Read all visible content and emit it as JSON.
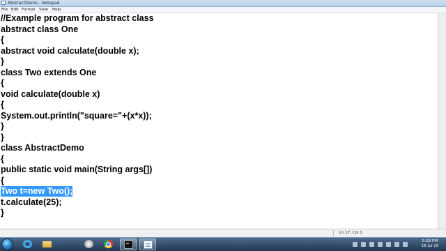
{
  "window": {
    "title": "AbstractDemo - Notepad"
  },
  "menu": [
    "File",
    "Edit",
    "Format",
    "View",
    "Help"
  ],
  "editor": {
    "lines": [
      "//Example program for abstract class",
      "abstract class One",
      "{",
      "abstract void calculate(double x);",
      "}",
      "class Two extends One",
      "{",
      "void calculate(double x)",
      "{",
      "System.out.println(\"square=\"+(x*x));",
      "}",
      "}",
      "class AbstractDemo",
      "{",
      "public static void main(String args[])",
      "{",
      "Two t=new Two();",
      "t.calculate(25);",
      "}"
    ],
    "selected_line_index": 16
  },
  "status": {
    "position": "Ln 17, Col 1"
  },
  "taskbar": {
    "apps": [
      {
        "icon": "internet-explorer-icon",
        "active": false
      },
      {
        "icon": "folder-icon",
        "active": false
      },
      {
        "icon": "media-player-icon",
        "active": false
      },
      {
        "icon": "chrome-icon",
        "active": false
      },
      {
        "icon": "command-prompt-icon",
        "active": true
      },
      {
        "icon": "notepad-icon",
        "active": true
      }
    ],
    "time": "5:18 PM",
    "date": "16-Jul-20"
  }
}
